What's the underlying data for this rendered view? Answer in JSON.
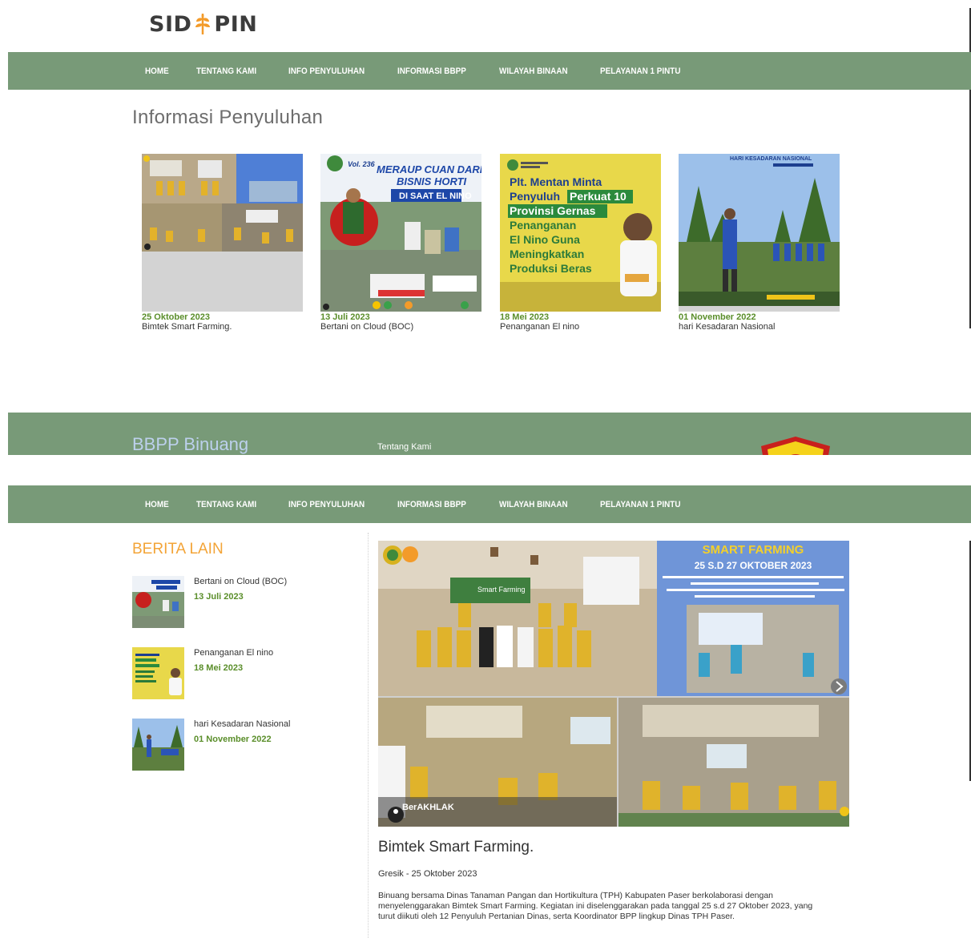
{
  "brand": {
    "logo_left": "SID",
    "logo_right": "PIN",
    "logo_color": "#3c3c3c",
    "logo_accent": "#f39b2a"
  },
  "nav": {
    "items": [
      "HOME",
      "TENTANG KAMI",
      "INFO PENYULUHAN",
      "INFORMASI BBPP",
      "WILAYAH BINAAN",
      "PELAYANAN 1 PINTU"
    ],
    "background": "#789a78"
  },
  "info": {
    "title": "Informasi Penyuluhan",
    "cards": [
      {
        "date": "25 Oktober 2023",
        "title": "Bimtek Smart Farming.",
        "image": "smart-farming-collage"
      },
      {
        "date": "13 Juli 2023",
        "title": "Bertani on Cloud (BOC)",
        "image": "bertani-on-cloud-poster",
        "poster": {
          "vol": "Vol. 236",
          "headline": "MERAUP CUAN DARI BISNIS HORTI",
          "sub": "DI SAAT EL NINO"
        }
      },
      {
        "date": "18 Mei 2023",
        "title": "Penanganan El nino",
        "image": "el-nino-poster",
        "poster": {
          "l1": "Plt. Mentan Minta",
          "l2a": "Penyuluh",
          "l2b": "Perkuat 10",
          "l3": "Provinsi Gernas",
          "l4": "Penanganan",
          "l5": "El Nino Guna",
          "l6": "Meningkatkan",
          "l7": "Produksi Beras"
        }
      },
      {
        "date": "01 November 2022",
        "title": "hari Kesadaran Nasional",
        "image": "kesadaran-nasional-photo",
        "poster": {
          "headline": "HARI KESADARAN NASIONAL"
        }
      }
    ]
  },
  "footer": {
    "title": "BBPP Binuang",
    "link": "Tentang Kami"
  },
  "berita_lain": {
    "title": "BERITA LAIN",
    "items": [
      {
        "title": "Bertani on Cloud (BOC)",
        "date": "13 Juli 2023"
      },
      {
        "title": "Penanganan El nino",
        "date": "18 Mei 2023"
      },
      {
        "title": "hari Kesadaran Nasional",
        "date": "01 November 2022"
      }
    ]
  },
  "article": {
    "title": "Bimtek Smart Farming.",
    "meta": "Gresik - 25 Oktober 2023",
    "hero": {
      "headline": "SMART FARMING",
      "dates": "25 S.D 27 OKTOBER 2023",
      "banner": "BerAKHLAK"
    },
    "body": "Binuang bersama Dinas Tanaman Pangan dan Hortikultura (TPH) Kabupaten Paser berkolaborasi dengan menyelenggarakan Bimtek Smart Farming. Kegiatan ini diselenggarakan pada tanggal 25 s.d 27 Oktober 2023, yang turut diikuti oleh 12 Penyuluh Pertanian Dinas, serta Koordinator BPP lingkup Dinas TPH Paser."
  },
  "colors": {
    "date_green": "#5a8e2a",
    "accent_orange": "#f3a437",
    "footer_title": "#bcd0ec"
  }
}
